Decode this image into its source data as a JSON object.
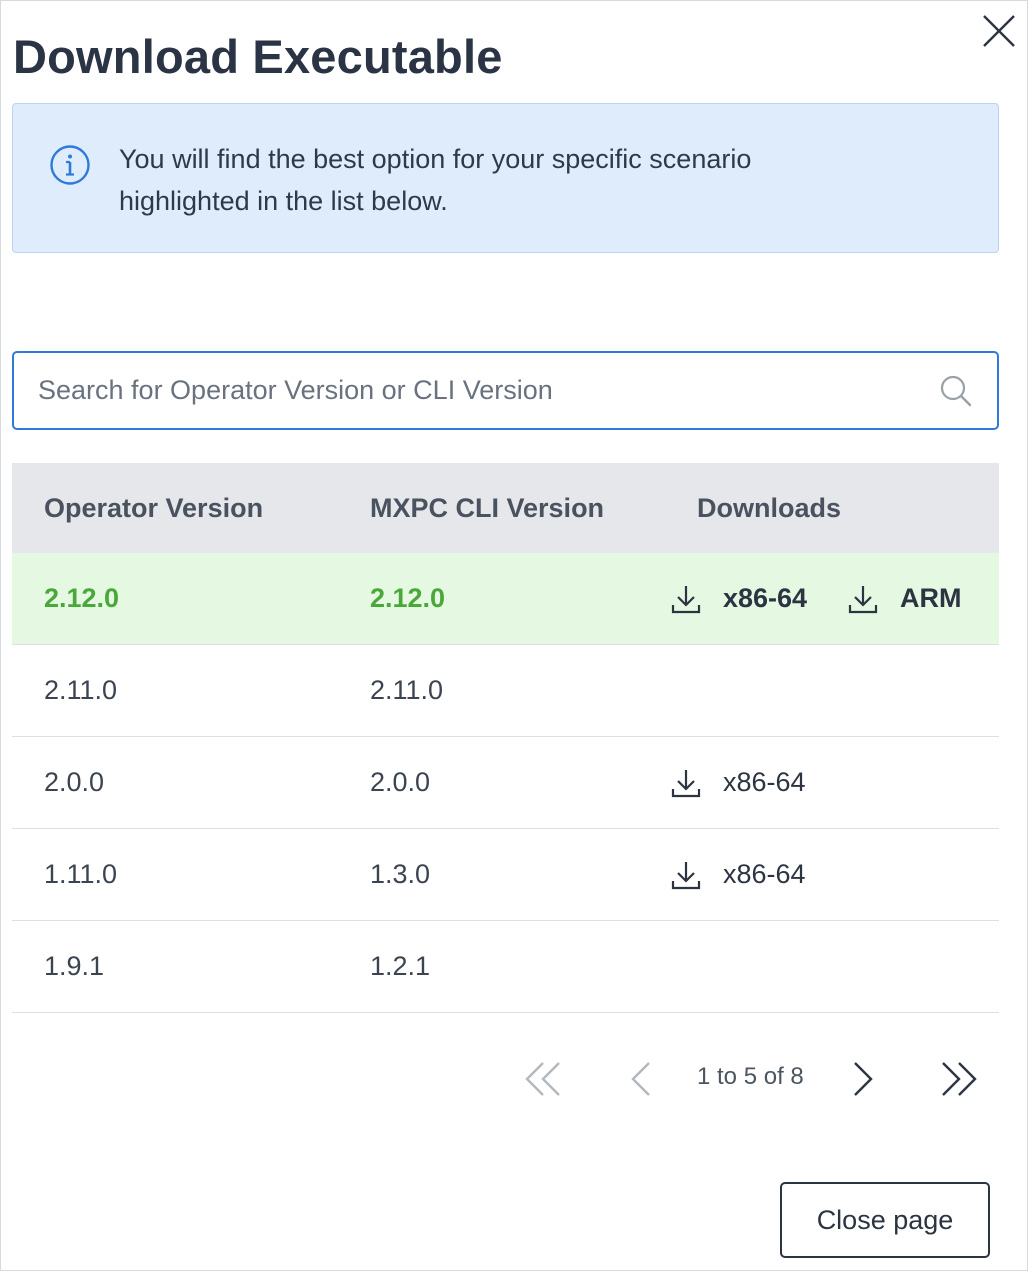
{
  "dialog": {
    "title": "Download Executable",
    "info_text": "You will find the best option for your specific scenario highlighted in the list below.",
    "search": {
      "placeholder": "Search for Operator Version or CLI Version",
      "value": ""
    },
    "table": {
      "headers": [
        "Operator Version",
        "MXPC CLI Version",
        "Downloads"
      ],
      "rows": [
        {
          "operator": "2.12.0",
          "cli": "2.12.0",
          "downloads": [
            "x86-64",
            "ARM"
          ],
          "highlighted": true
        },
        {
          "operator": "2.11.0",
          "cli": "2.11.0",
          "downloads": []
        },
        {
          "operator": "2.0.0",
          "cli": "2.0.0",
          "downloads": [
            "x86-64"
          ]
        },
        {
          "operator": "1.11.0",
          "cli": "1.3.0",
          "downloads": [
            "x86-64"
          ]
        },
        {
          "operator": "1.9.1",
          "cli": "1.2.1",
          "downloads": []
        }
      ]
    },
    "pagination": {
      "range_text": "1 to 5 of 8"
    },
    "close_page_label": "Close page"
  },
  "icons": {
    "close": "close-icon",
    "info": "info-icon",
    "search": "search-icon",
    "download": "download-icon",
    "first": "double-chevron-left-icon",
    "prev": "chevron-left-icon",
    "next": "chevron-right-icon",
    "last": "double-chevron-right-icon"
  },
  "colors": {
    "highlight_bg": "#e5f8e2",
    "highlight_text": "#4aa83b",
    "info_bg": "#dfecfb",
    "search_border": "#2f7ad8",
    "header_bg": "#e6e7ea"
  }
}
